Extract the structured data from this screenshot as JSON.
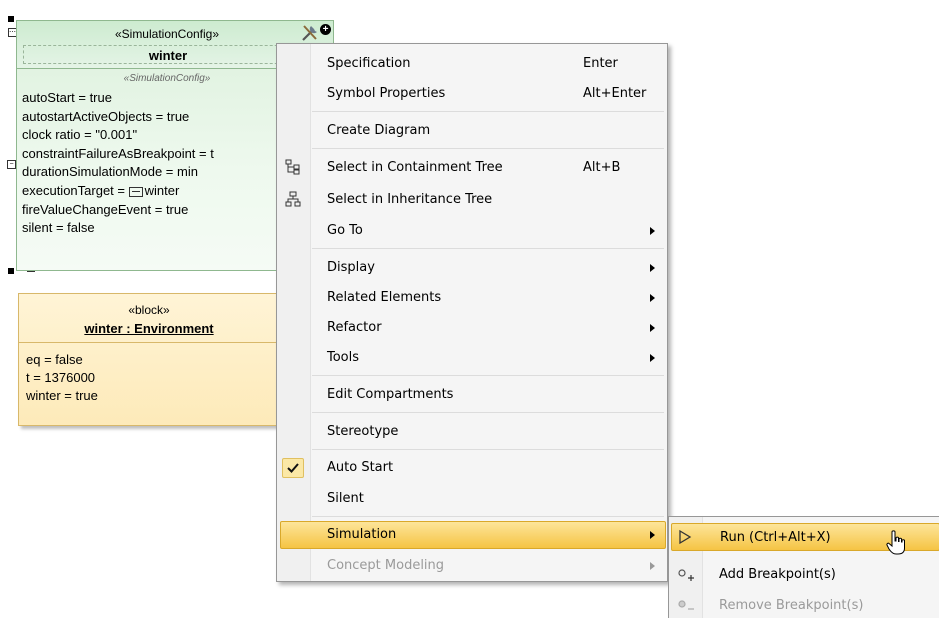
{
  "sim_config": {
    "stereotype": "«SimulationConfig»",
    "name": "winter",
    "compartment_stereotype": "«SimulationConfig»",
    "properties": [
      "autoStart = true",
      "autostartActiveObjects = true",
      "clock ratio = \"0.001\"",
      "constraintFailureAsBreakpoint = t",
      "durationSimulationMode = min",
      "executionTarget = ",
      "fireValueChangeEvent = true",
      "silent = false"
    ],
    "execution_target_value": "winter"
  },
  "block": {
    "stereotype": "«block»",
    "title": "winter : Environment",
    "properties": [
      "eq = false",
      "t = 1376000",
      "winter = true"
    ]
  },
  "context_menu": {
    "items": [
      {
        "label": "Specification",
        "accel": "Enter"
      },
      {
        "label": "Symbol Properties",
        "accel": "Alt+Enter"
      },
      {
        "label": "Create Diagram",
        "accel": ""
      },
      {
        "label": "Select in Containment Tree",
        "accel": "Alt+B",
        "icon": "containment-tree-icon"
      },
      {
        "label": "Select in Inheritance Tree",
        "accel": "",
        "icon": "inheritance-tree-icon"
      },
      {
        "label": "Go To",
        "accel": "",
        "submenu": true
      },
      {
        "label": "Display",
        "accel": "",
        "submenu": true
      },
      {
        "label": "Related Elements",
        "accel": "",
        "submenu": true
      },
      {
        "label": "Refactor",
        "accel": "",
        "submenu": true
      },
      {
        "label": "Tools",
        "accel": "",
        "submenu": true
      },
      {
        "label": "Edit Compartments",
        "accel": ""
      },
      {
        "label": "Stereotype",
        "accel": ""
      },
      {
        "label": "Auto Start",
        "accel": "",
        "checked": true
      },
      {
        "label": "Silent",
        "accel": ""
      },
      {
        "label": "Simulation",
        "accel": "",
        "submenu": true,
        "highlighted": true
      },
      {
        "label": "Concept Modeling",
        "accel": "",
        "submenu": true,
        "disabled": true
      }
    ]
  },
  "sub_menu": {
    "items": [
      {
        "label": "Run (Ctrl+Alt+X)",
        "icon": "play-icon",
        "highlighted": true
      },
      {
        "label": "Add Breakpoint(s)",
        "icon": "add-breakpoint-icon"
      },
      {
        "label": "Remove Breakpoint(s)",
        "icon": "remove-breakpoint-icon",
        "disabled": true
      }
    ]
  },
  "colors": {
    "highlight": "#f5c444",
    "sim_config_fill": "#e4f4e6",
    "block_fill": "#fdeab9"
  }
}
